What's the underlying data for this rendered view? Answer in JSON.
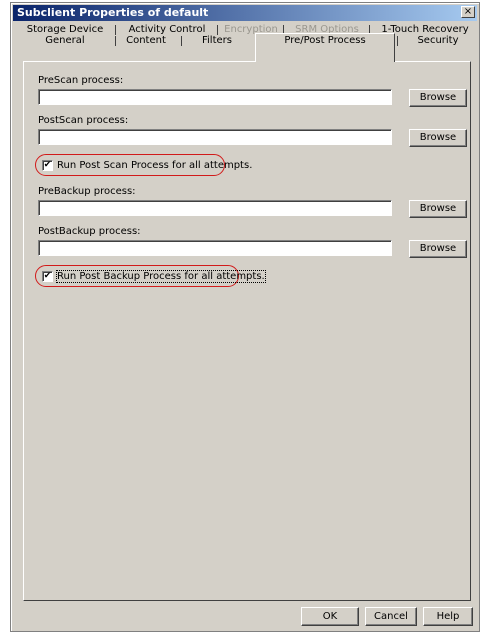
{
  "window": {
    "title": "Subclient Properties of default",
    "close_glyph": "×"
  },
  "tabs": {
    "row1": [
      {
        "label": "Storage Device",
        "enabled": true
      },
      {
        "label": "Activity Control",
        "enabled": true
      },
      {
        "label": "Encryption",
        "enabled": false
      },
      {
        "label": "SRM Options",
        "enabled": false
      },
      {
        "label": "1-Touch Recovery",
        "enabled": true
      }
    ],
    "row2": [
      {
        "label": "General"
      },
      {
        "label": "Content"
      },
      {
        "label": "Filters"
      },
      {
        "label": "Pre/Post Process",
        "active": true
      },
      {
        "label": "Security"
      }
    ]
  },
  "form": {
    "prescan": {
      "label": "PreScan process:",
      "value": "",
      "button": "Browse"
    },
    "postscan": {
      "label": "PostScan process:",
      "value": "",
      "button": "Browse"
    },
    "postscan_all": {
      "label": "Run Post Scan Process for all attempts.",
      "checked": true
    },
    "prebackup": {
      "label": "PreBackup process:",
      "value": "",
      "button": "Browse"
    },
    "postbackup": {
      "label": "PostBackup process:",
      "value": "",
      "button": "Browse"
    },
    "postbackup_all": {
      "label": "Run Post Backup Process for all attempts.",
      "checked": true
    }
  },
  "footer": {
    "ok": "OK",
    "cancel": "Cancel",
    "help": "Help"
  },
  "icons": {
    "check_glyph": "✔"
  },
  "colors": {
    "dialog_bg": "#d4d0c8",
    "titlebar_start": "#0a246a",
    "titlebar_end": "#a6caf0",
    "highlight_ring": "#d11a1a"
  }
}
